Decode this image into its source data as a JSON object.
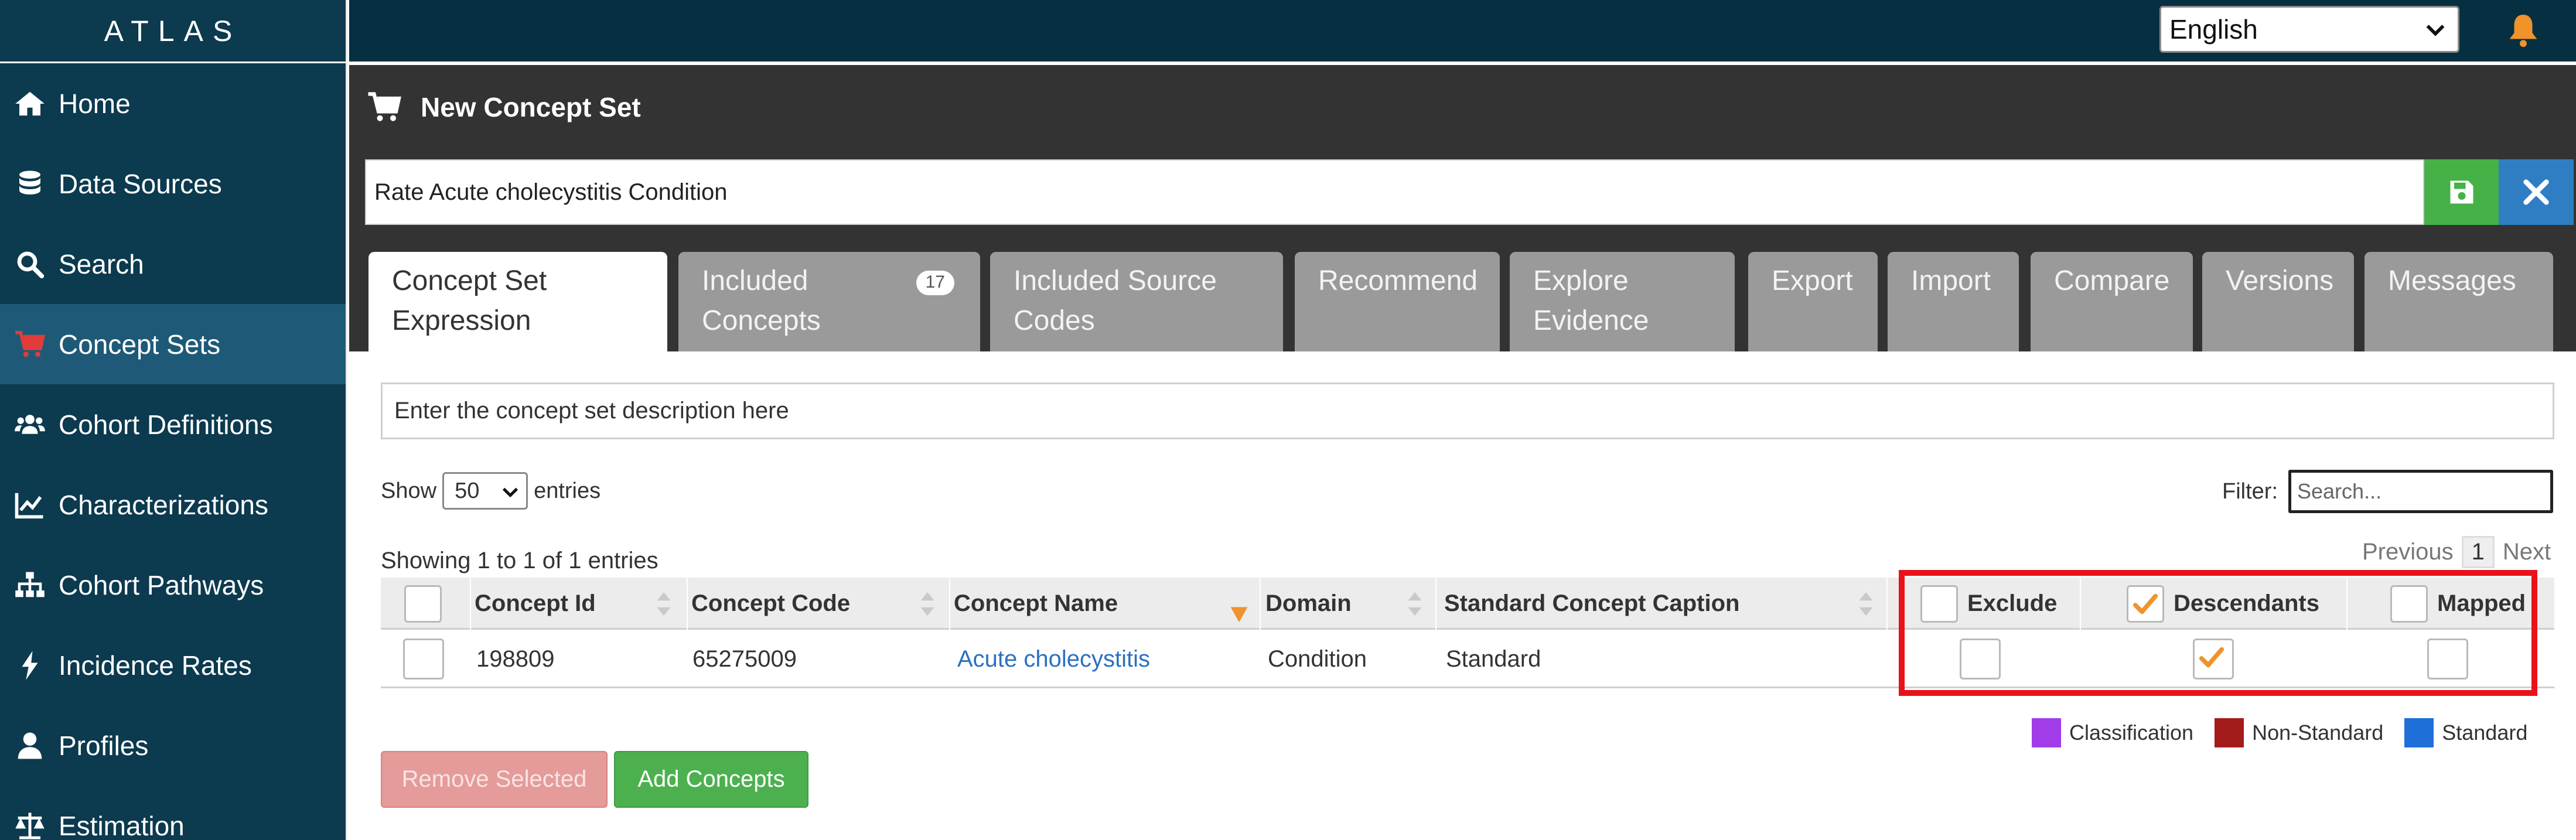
{
  "app": {
    "brand": "ATLAS"
  },
  "sidebar": {
    "items": [
      {
        "label": "Home",
        "icon": "home-icon"
      },
      {
        "label": "Data Sources",
        "icon": "database-icon"
      },
      {
        "label": "Search",
        "icon": "search-icon"
      },
      {
        "label": "Concept Sets",
        "icon": "cart-icon",
        "active": true
      },
      {
        "label": "Cohort Definitions",
        "icon": "users-icon"
      },
      {
        "label": "Characterizations",
        "icon": "line-chart-icon"
      },
      {
        "label": "Cohort Pathways",
        "icon": "sitemap-icon"
      },
      {
        "label": "Incidence Rates",
        "icon": "bolt-icon"
      },
      {
        "label": "Profiles",
        "icon": "user-icon"
      },
      {
        "label": "Estimation",
        "icon": "balance-scale-icon"
      }
    ]
  },
  "topbar": {
    "language": "English"
  },
  "header": {
    "title": "New Concept Set",
    "name_value": "Rate Acute cholecystitis Condition"
  },
  "tabs": [
    {
      "line1": "Concept Set",
      "line2": "Expression",
      "active": true
    },
    {
      "line1": "Included",
      "line2": "Concepts",
      "badge": "17"
    },
    {
      "line1": "Included Source",
      "line2": "Codes"
    },
    {
      "line1": "Recommend",
      "line2": ""
    },
    {
      "line1": "Explore",
      "line2": "Evidence"
    },
    {
      "line1": "Export",
      "line2": ""
    },
    {
      "line1": "Import",
      "line2": ""
    },
    {
      "line1": "Compare",
      "line2": ""
    },
    {
      "line1": "Versions",
      "line2": ""
    },
    {
      "line1": "Messages",
      "line2": ""
    }
  ],
  "content": {
    "description_placeholder": "Enter the concept set description here",
    "show_label": "Show",
    "entries_length": "50",
    "entries_label": "entries",
    "filter_label": "Filter:",
    "filter_placeholder": "Search...",
    "info": "Showing 1 to 1 of 1 entries",
    "pager": {
      "previous": "Previous",
      "page": "1",
      "next": "Next"
    }
  },
  "table": {
    "columns": [
      "Concept Id",
      "Concept Code",
      "Concept Name",
      "Domain",
      "Standard Concept Caption",
      "Exclude",
      "Descendants",
      "Mapped"
    ],
    "rows": [
      {
        "concept_id": "198809",
        "concept_code": "65275009",
        "concept_name": "Acute cholecystitis",
        "domain": "Condition",
        "standard": "Standard",
        "exclude": false,
        "descendants": true,
        "mapped": false
      }
    ],
    "header_checks": {
      "select_all": false,
      "exclude": false,
      "descendants": true,
      "mapped": false
    }
  },
  "legend": [
    {
      "label": "Classification",
      "color": "#a23ce8"
    },
    {
      "label": "Non-Standard",
      "color": "#a31b1b"
    },
    {
      "label": "Standard",
      "color": "#1f6fd8"
    }
  ],
  "buttons": {
    "remove": "Remove Selected",
    "add": "Add Concepts"
  },
  "colors": {
    "sidebar_bg": "#0c3a4f",
    "sidebar_active": "#1e5a78",
    "topbar_bg": "#063042",
    "header_bg": "#333333",
    "accent_orange": "#f0932b",
    "highlight_red": "#e8121b"
  }
}
